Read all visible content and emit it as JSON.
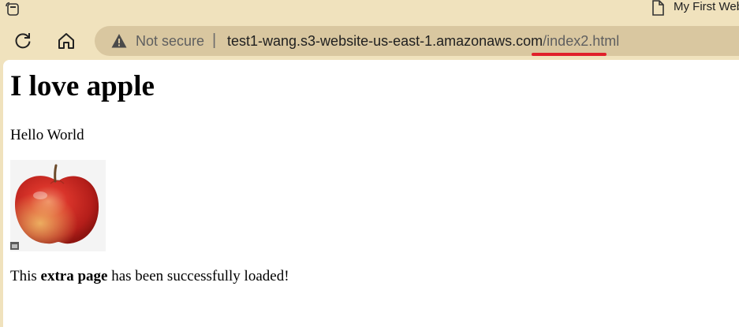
{
  "browser": {
    "tab": {
      "title": "My First Website",
      "icon": "document-icon"
    },
    "toolbar": {
      "refresh_icon": "refresh-icon",
      "home_icon": "home-icon",
      "security_label": "Not secure",
      "separator": "|",
      "url_host": "test1-wang.s3-website-us-east-1.amazonaws.com",
      "url_path": "/index2.html",
      "annotation_color": "#e0202a"
    }
  },
  "page": {
    "heading": "I love apple",
    "paragraph": "Hello World",
    "image_alt": "apple",
    "extra": {
      "before": "This ",
      "bold": "extra page",
      "after": " has been successfully loaded!"
    }
  }
}
